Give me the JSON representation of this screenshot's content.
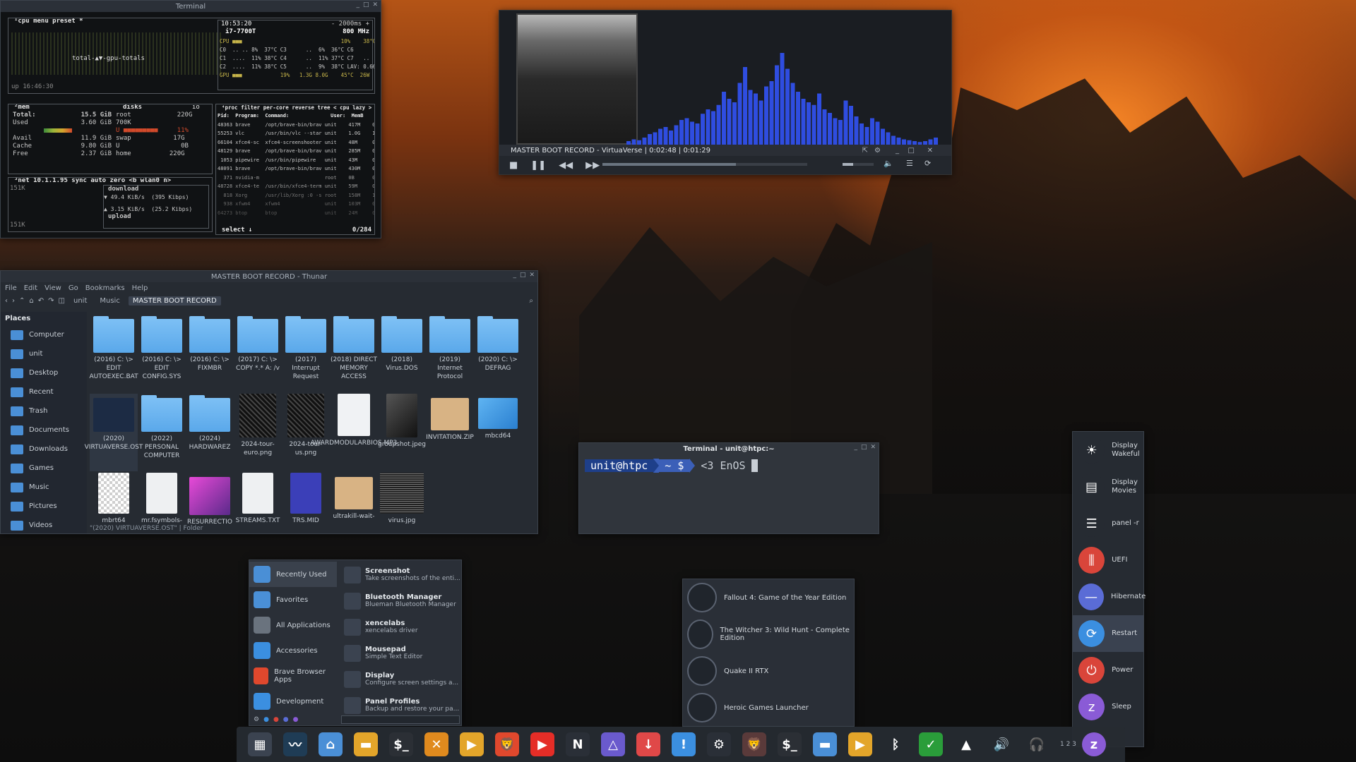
{
  "btop": {
    "title": "Terminal",
    "cpu_header": "¹cpu   menu  preset *",
    "clock": "10:53:20",
    "refresh": "- 2000ms +",
    "cpu_model": "i7-7700T",
    "freq": "800 MHz",
    "gpu_totals": "total-▲▼-gpu-totals",
    "uptime": "up 16:46:30",
    "cpu_rows": [
      "CPU ■■■                               10%    38°C",
      "C0  .. .. 8%  37°C C3      ..  6%  36°C C6       6%  36°C",
      "C1  ....  11% 38°C C4      ..  11% 37°C C7   ..  17% 36°C",
      "C2  ....  11% 38°C C5      ..  9%  38°C LAV: 0.66 0.56 0.44",
      "GPU ■■■            19%   1.3G 8.0G    45°C  26W"
    ],
    "mem_header": "²mem",
    "disks_header": "disks",
    "io_label": "io",
    "mem_rows": [
      {
        "label": "Total:",
        "value": "15.5 GiB"
      },
      {
        "label": "Used",
        "value": "3.60 GiB"
      },
      {
        "label": "Avail",
        "value": "11.9 GiB"
      },
      {
        "label": "Cache",
        "value": "9.80 GiB"
      },
      {
        "label": "Free",
        "value": "2.37 GiB"
      }
    ],
    "disk_rows": [
      "root            220G",
      "700K",
      "U ■■■■■■■■■     11%",
      "swap           17G",
      "U                0B",
      "home          220G"
    ],
    "proc_header": "⁴proc  filter     per-core  reverse  tree  < cpu lazy >",
    "proc_cols": "Pid:  Program:  Command:              User:  MemB    Cpu%",
    "proc_rows": [
      "48363 brave     /opt/brave-bin/brav unit    417M    0.0",
      "55253 vlc       /usr/bin/vlc --star unit    1.0G    1.5",
      "66104 xfce4-sc  xfce4-screenshooter unit    48M     0.8",
      "48129 brave     /opt/brave-bin/brav unit    285M    0.0",
      " 1053 pipewire  /usr/bin/pipewire   unit    43M     0.5",
      "48091 brave     /opt/brave-bin/brav unit    430M    0.0",
      "  371 nvidia-m                      root    0B      0.1",
      "48728 xfce4-te  /usr/bin/xfce4-term unit    59M     0.1",
      "  818 Xorg      /usr/lib/Xorg :0 -s root    158M    1.0",
      "  938 xfwm4     xfwm4               unit    103M    0.4",
      "64273 btop      btop                unit    24M     0.8"
    ],
    "proc_footer": "select ↓",
    "proc_count": "0/284",
    "net_header": "³net   10.1.1.95    sync  auto  zero  <b wlan0 n>",
    "net_scale": "151K",
    "net_scale_low": "151K",
    "download_label": "download",
    "download_value": "▼ 49.4 KiB/s  (395 Kibps)",
    "upload_value": "▲ 3.15 KiB/s  (25.2 Kibps)",
    "upload_label": "upload"
  },
  "player": {
    "title": "MASTER BOOT RECORD - VirtuaVerse",
    "elapsed": "0:02:48",
    "remaining": "0:01:29",
    "progress": 0.65,
    "volume": 0.35,
    "spectrum": [
      4,
      6,
      5,
      8,
      12,
      14,
      18,
      20,
      16,
      22,
      28,
      30,
      26,
      24,
      35,
      40,
      38,
      45,
      60,
      52,
      48,
      70,
      88,
      62,
      58,
      50,
      66,
      72,
      90,
      104,
      86,
      70,
      60,
      52,
      48,
      45,
      58,
      40,
      36,
      30,
      28,
      50,
      44,
      32,
      24,
      20,
      30,
      26,
      18,
      14,
      10,
      8,
      6,
      5,
      4,
      3,
      4,
      6,
      8
    ]
  },
  "thunar": {
    "title": "MASTER BOOT RECORD - Thunar",
    "menu": [
      "File",
      "Edit",
      "View",
      "Go",
      "Bookmarks",
      "Help"
    ],
    "breadcrumbs": [
      "unit",
      "Music",
      "MASTER BOOT RECORD"
    ],
    "places_heading": "Places",
    "places": [
      "Computer",
      "unit",
      "Desktop",
      "Recent",
      "Trash",
      "Documents",
      "Downloads",
      "Games",
      "Music",
      "Pictures",
      "Videos"
    ],
    "files": [
      {
        "name": "(2016) C: \\> EDIT AUTOEXEC.BAT",
        "kind": "folder"
      },
      {
        "name": "(2016) C: \\> EDIT CONFIG.SYS",
        "kind": "folder"
      },
      {
        "name": "(2016) C: \\> FIXMBR",
        "kind": "folder"
      },
      {
        "name": "(2017) C: \\> COPY *.* A: /v",
        "kind": "folder"
      },
      {
        "name": "(2017) Interrupt Request",
        "kind": "folder"
      },
      {
        "name": "(2018) DIRECT MEMORY ACCESS",
        "kind": "folder"
      },
      {
        "name": "(2018) Virus.DOS",
        "kind": "folder"
      },
      {
        "name": "(2019) Internet Protocol",
        "kind": "folder"
      },
      {
        "name": "(2020) C: \\> DEFRAG",
        "kind": "folder"
      },
      {
        "name": "(2020) VIRTUAVERSE.OST",
        "kind": "folder-dark"
      },
      {
        "name": "(2022) PERSONAL COMPUTER",
        "kind": "folder"
      },
      {
        "name": "(2024) HARDWAREZ",
        "kind": "folder"
      },
      {
        "name": "2024-tour-euro.png",
        "kind": "poster"
      },
      {
        "name": "2024-tour-us.png",
        "kind": "poster"
      },
      {
        "name": "AWARDMODULARBIOS.MP3",
        "kind": "audio"
      },
      {
        "name": "groupshot.jpeg",
        "kind": "photo"
      },
      {
        "name": "INVITATION.ZIP",
        "kind": "archive"
      },
      {
        "name": "mbcd64",
        "kind": "image"
      },
      {
        "name": "mbrt64",
        "kind": "checker"
      },
      {
        "name": "mr.fsymbols-",
        "kind": "text"
      },
      {
        "name": "RESURRECTIO",
        "kind": "pink"
      },
      {
        "name": "STREAMS.TXT",
        "kind": "text"
      },
      {
        "name": "TRS.MID",
        "kind": "midi"
      },
      {
        "name": "ultrakill-wait-",
        "kind": "archive"
      },
      {
        "name": "virus.jpg",
        "kind": "noise"
      }
    ],
    "status": "\"(2020) VIRTUAVERSE.OST\"  |  Folder"
  },
  "terminal2": {
    "title": "Terminal - unit@htpc:~",
    "prompt_user": "unit@htpc",
    "prompt_path": "~ $",
    "command": "<3 EnOS"
  },
  "appmenu": {
    "categories": [
      "Recently Used",
      "Favorites",
      "All Applications",
      "Accessories",
      "Brave Browser Apps",
      "Development"
    ],
    "apps": [
      {
        "name": "Screenshot",
        "desc": "Take screenshots of the enti..."
      },
      {
        "name": "Bluetooth Manager",
        "desc": "Blueman Bluetooth Manager"
      },
      {
        "name": "xencelabs",
        "desc": "xencelabs driver"
      },
      {
        "name": "Mousepad",
        "desc": "Simple Text Editor"
      },
      {
        "name": "Display",
        "desc": "Configure screen settings a..."
      },
      {
        "name": "Panel Profiles",
        "desc": "Backup and restore your pa..."
      }
    ]
  },
  "games": [
    "Fallout 4: Game of the Year Edition",
    "The Witcher 3: Wild Hunt - Complete Edition",
    "Quake II RTX",
    "Heroic Games Launcher"
  ],
  "power": [
    {
      "label": "Display Wakeful",
      "icon": "sun-icon",
      "color": "#262b32"
    },
    {
      "label": "Display Movies",
      "icon": "film-icon",
      "color": "#262b32"
    },
    {
      "label": "panel -r",
      "icon": "panel-icon",
      "color": "#262b32"
    },
    {
      "label": "UEFI",
      "icon": "sliders-icon",
      "color": "#d9453a"
    },
    {
      "label": "Hibernate",
      "icon": "minus-icon",
      "color": "#5a6cd6"
    },
    {
      "label": "Restart",
      "icon": "restart-icon",
      "color": "#3b8fe0"
    },
    {
      "label": "Power",
      "icon": "power-icon",
      "color": "#d9453a"
    },
    {
      "label": "Sleep",
      "icon": "sleep-icon",
      "color": "#8a5bd6"
    }
  ],
  "dock": {
    "workspaces": "1 2 3",
    "items": [
      {
        "name": "app-grid-icon",
        "glyph": "▦",
        "color": "#3b4350"
      },
      {
        "name": "system-monitor-icon",
        "glyph": "〰",
        "color": "#1f3c55"
      },
      {
        "name": "home-folder-icon",
        "glyph": "⌂",
        "color": "#4a8fd6"
      },
      {
        "name": "file-manager-icon",
        "glyph": "▬",
        "color": "#e3a52a"
      },
      {
        "name": "terminal-icon",
        "glyph": "$_",
        "color": "#2b2f35"
      },
      {
        "name": "xbox-icon",
        "glyph": "✕",
        "color": "#e08a1e"
      },
      {
        "name": "media-player-icon",
        "glyph": "▶",
        "color": "#e3a52a"
      },
      {
        "name": "brave-icon",
        "glyph": "🦁",
        "color": "#e0482d"
      },
      {
        "name": "youtube-icon",
        "glyph": "▶",
        "color": "#e52d27"
      },
      {
        "name": "netflix-icon",
        "glyph": "N",
        "color": "#2a2f37"
      },
      {
        "name": "prism-icon",
        "glyph": "△",
        "color": "#6a5acd"
      },
      {
        "name": "download-icon",
        "glyph": "↓",
        "color": "#e04848"
      },
      {
        "name": "heroic-icon",
        "glyph": "!",
        "color": "#3b8fe0"
      },
      {
        "name": "steam-icon",
        "glyph": "⚙",
        "color": "#2a2f37"
      },
      {
        "name": "brave-running-icon",
        "glyph": "🦁",
        "color": "#5a3a3a"
      },
      {
        "name": "terminal-running-icon",
        "glyph": "$_",
        "color": "#2b2f35"
      },
      {
        "name": "folder-running-icon",
        "glyph": "▬",
        "color": "#4a8fd6"
      },
      {
        "name": "vlc-running-icon",
        "glyph": "▶",
        "color": "#e3a52a"
      },
      {
        "name": "bluetooth-icon",
        "glyph": "ᛒ",
        "color": "transparent"
      },
      {
        "name": "shield-icon",
        "glyph": "✓",
        "color": "#2a9d3a"
      },
      {
        "name": "xencelabs-icon",
        "glyph": "▲",
        "color": "transparent"
      },
      {
        "name": "volume-icon",
        "glyph": "🔊",
        "color": "transparent"
      },
      {
        "name": "headphones-icon",
        "glyph": "🎧",
        "color": "transparent"
      }
    ]
  }
}
